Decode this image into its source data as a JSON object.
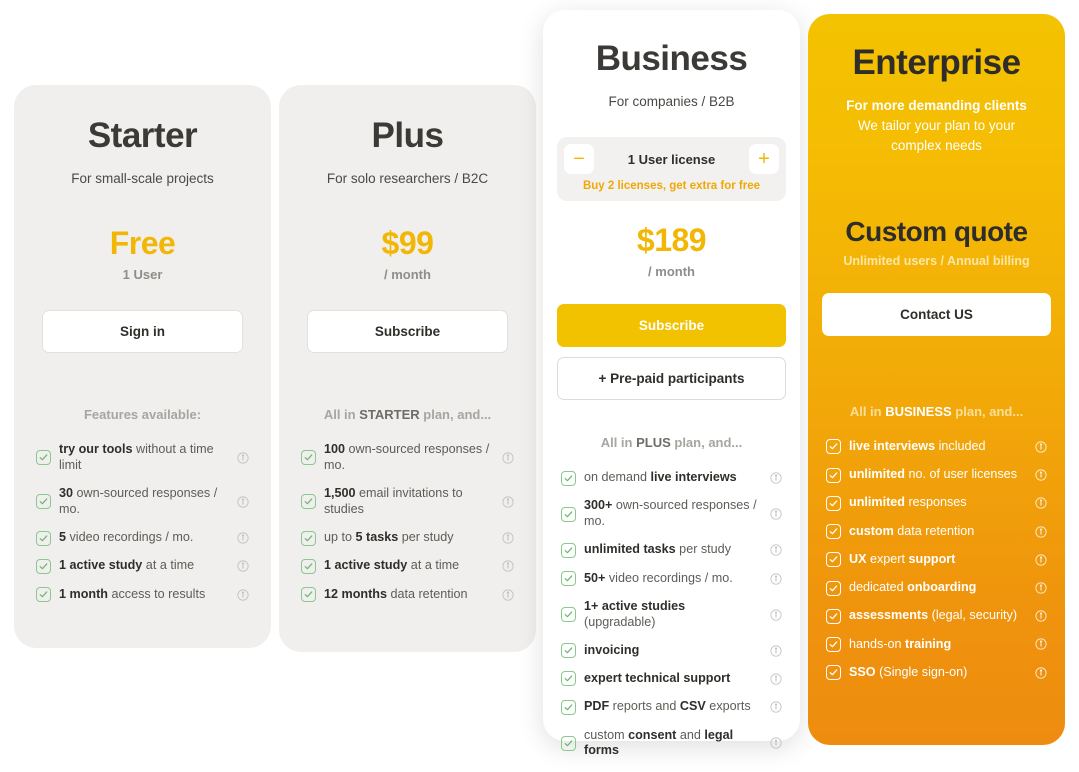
{
  "colors": {
    "accent_yellow": "#f2c200",
    "price_yellow": "#f2b705",
    "card_gray": "#f0efed",
    "enterprise_gradient_top": "#f3c200",
    "enterprise_gradient_bottom": "#ee8c0f",
    "check_green": "#89c98d",
    "text_dark": "#2f2e2a",
    "text_muted": "#8e8d89"
  },
  "plans": {
    "starter": {
      "name": "Starter",
      "tagline": "For small-scale projects",
      "price": "Free",
      "period": "1 User",
      "cta": "Sign in",
      "features_heading_prefix": "Features available:",
      "features_heading_highlight": "",
      "features_heading_suffix": "",
      "features": [
        {
          "bold_lead": "try our tools",
          "rest": " without a time limit",
          "info": "info-icon"
        },
        {
          "bold_lead": "30",
          "rest": " own-sourced responses / mo.",
          "info": "info-icon"
        },
        {
          "bold_lead": "5",
          "rest": " video recordings / mo.",
          "info": "info-icon"
        },
        {
          "bold_lead": "1 active study",
          "rest": " at a time",
          "info": "info-icon"
        },
        {
          "bold_lead": "1 month",
          "rest": " access to results",
          "info": "info-icon"
        }
      ]
    },
    "plus": {
      "name": "Plus",
      "tagline": "For solo researchers / B2C",
      "price": "$99",
      "period": "/ month",
      "cta": "Subscribe",
      "features_heading_prefix": "All in ",
      "features_heading_highlight": "STARTER",
      "features_heading_suffix": " plan, and...",
      "features": [
        {
          "bold_lead": "100",
          "rest": " own-sourced responses / mo.",
          "info": "info-icon"
        },
        {
          "bold_lead": "1,500",
          "rest": " email invitations to studies",
          "info": "info-icon"
        },
        {
          "bold_lead": "",
          "pre": "up to ",
          "mid_bold": "5 tasks",
          "rest": " per study",
          "info": "info-icon"
        },
        {
          "bold_lead": "1 active study",
          "rest": " at a time",
          "info": "info-icon"
        },
        {
          "bold_lead": "12 months",
          "rest": " data retention",
          "info": "info-icon"
        }
      ]
    },
    "business": {
      "name": "Business",
      "tagline": "For companies / B2B",
      "license_label": "1 User license",
      "license_decrement": "−",
      "license_increment": "+",
      "license_promo": "Buy 2 licenses, get extra for free",
      "price": "$189",
      "period": "/ month",
      "cta": "Subscribe",
      "cta_secondary": "+ Pre-paid participants",
      "features_heading_prefix": "All in ",
      "features_heading_highlight": "PLUS",
      "features_heading_suffix": " plan, and...",
      "features": [
        {
          "pre": "on demand ",
          "mid_bold": "live interviews",
          "rest": "",
          "info": "info-icon"
        },
        {
          "bold_lead": "300+",
          "rest": " own-sourced responses / mo.",
          "info": "info-icon"
        },
        {
          "bold_lead": "unlimited tasks",
          "rest": " per study",
          "info": "info-icon"
        },
        {
          "bold_lead": "50+",
          "rest": " video recordings / mo.",
          "info": "info-icon"
        },
        {
          "bold_lead": "1+ active studies",
          "rest": " (upgradable)",
          "info": "info-icon"
        },
        {
          "bold_lead": "invoicing",
          "rest": "",
          "info": "info-icon"
        },
        {
          "bold_lead": "expert technical support",
          "rest": "",
          "info": "info-icon"
        },
        {
          "bold_lead": "PDF",
          "rest": " reports and ",
          "mid_bold2": "CSV",
          "rest2": " exports",
          "info": "info-icon"
        },
        {
          "pre": "custom ",
          "mid_bold": "consent",
          "rest": " and ",
          "mid_bold2": "legal forms",
          "rest2": "",
          "info": "info-icon"
        }
      ]
    },
    "enterprise": {
      "name": "Enterprise",
      "tagline": "For more demanding clients",
      "subtagline": "We tailor your plan to your complex needs",
      "price": "Custom quote",
      "period": "Unlimited users / Annual billing",
      "cta": "Contact US",
      "features_heading_prefix": "All in ",
      "features_heading_highlight": "BUSINESS",
      "features_heading_suffix": " plan, and...",
      "features": [
        {
          "bold_lead": "live interviews",
          "rest": " included",
          "info": "info-icon"
        },
        {
          "bold_lead": "unlimited",
          "rest": " no. of user licenses",
          "info": "info-icon"
        },
        {
          "bold_lead": "unlimited",
          "rest": " responses",
          "info": "info-icon"
        },
        {
          "bold_lead": "custom",
          "rest": " data retention",
          "info": "info-icon"
        },
        {
          "bold_lead": "UX",
          "rest": " expert ",
          "mid_bold2": "support",
          "rest2": "",
          "info": "info-icon"
        },
        {
          "pre": "dedicated ",
          "mid_bold": "onboarding",
          "rest": "",
          "info": "info-icon"
        },
        {
          "bold_lead": "assessments",
          "rest": " (legal, security)",
          "info": "info-icon"
        },
        {
          "pre": "hands-on ",
          "mid_bold": "training",
          "rest": "",
          "info": "info-icon"
        },
        {
          "bold_lead": "SSO",
          "rest": " (Single sign-on)",
          "info": "info-icon"
        }
      ]
    }
  }
}
